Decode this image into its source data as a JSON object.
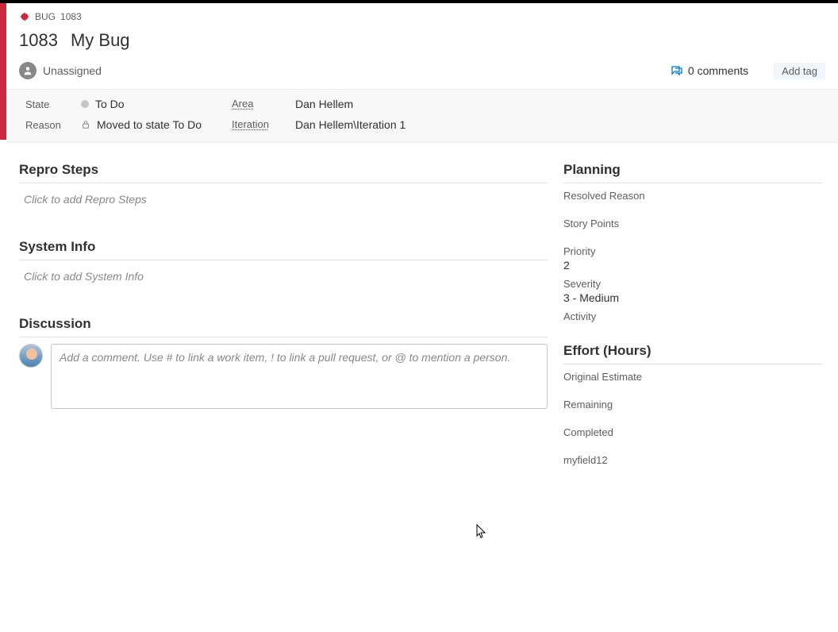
{
  "crumb": {
    "type": "BUG",
    "id": "1083"
  },
  "title": {
    "id": "1083",
    "text": "My Bug"
  },
  "assignee": "Unassigned",
  "comments": {
    "count": 0,
    "label": "0 comments"
  },
  "addtag_label": "Add tag",
  "fields": {
    "state_label": "State",
    "state_value": "To Do",
    "reason_label": "Reason",
    "reason_value": "Moved to state To Do",
    "area_label": "Area",
    "area_value": "Dan Hellem",
    "iteration_label": "Iteration",
    "iteration_value": "Dan Hellem\\Iteration 1"
  },
  "sections": {
    "repro_title": "Repro Steps",
    "repro_placeholder": "Click to add Repro Steps",
    "sysinfo_title": "System Info",
    "sysinfo_placeholder": "Click to add System Info",
    "discussion_title": "Discussion",
    "discussion_placeholder": "Add a comment. Use # to link a work item, ! to link a pull request, or @ to mention a person."
  },
  "planning": {
    "title": "Planning",
    "resolved_reason_label": "Resolved Reason",
    "resolved_reason_value": "",
    "story_points_label": "Story Points",
    "story_points_value": "",
    "priority_label": "Priority",
    "priority_value": "2",
    "severity_label": "Severity",
    "severity_value": "3 - Medium",
    "activity_label": "Activity",
    "activity_value": ""
  },
  "effort": {
    "title": "Effort (Hours)",
    "original_label": "Original Estimate",
    "original_value": "",
    "remaining_label": "Remaining",
    "remaining_value": "",
    "completed_label": "Completed",
    "completed_value": "",
    "custom1_label": "myfield12",
    "custom1_value": ""
  }
}
